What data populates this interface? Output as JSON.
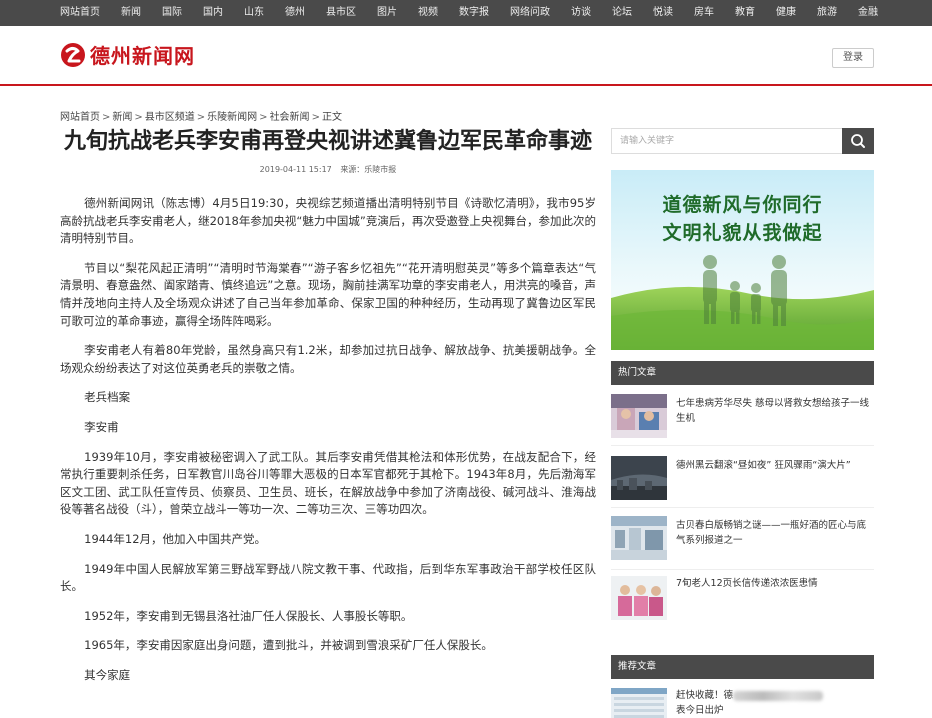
{
  "topnav": {
    "items": [
      "网站首页",
      "新闻",
      "国际",
      "国内",
      "山东",
      "德州",
      "县市区",
      "图片",
      "视频",
      "数字报",
      "网络问政",
      "访谈",
      "论坛",
      "悦读",
      "房车",
      "教育",
      "健康",
      "旅游",
      "金融"
    ]
  },
  "header": {
    "logo_text": "德州新闻网",
    "login_label": "登录",
    "brand_color": "#c8161d"
  },
  "breadcrumb": {
    "items": [
      "网站首页",
      "新闻",
      "县市区频道",
      "乐陵新闻网",
      "社会新闻",
      "正文"
    ],
    "separator": ">"
  },
  "article": {
    "title": "九旬抗战老兵李安甫再登央视讲述冀鲁边军民革命事迹",
    "date": "2019-04-11 15:17",
    "source": "来源：乐陵市报",
    "paragraphs": [
      "德州新闻网讯（陈志博）4月5日19:30，央视综艺频道播出清明特别节目《诗歌忆清明》，我市95岁高龄抗战老兵李安甫老人，继2018年参加央视“魅力中国城”竞演后，再次受邀登上央视舞台，参加此次的清明特别节目。",
      "节目以“梨花风起正清明”“清明时节海棠春”“游子客乡忆祖先”“花开清明慰英灵”等多个篇章表达“气清景明、春意盎然、阖家踏青、慎终追远”之意。现场，胸前挂满军功章的李安甫老人，用洪亮的嗓音，声情并茂地向主持人及全场观众讲述了自己当年参加革命、保家卫国的种种经历，生动再现了冀鲁边区军民可歌可泣的革命事迹，赢得全场阵阵喝彩。",
      "李安甫老人有着80年党龄，虽然身高只有1.2米，却参加过抗日战争、解放战争、抗美援朝战争。全场观众纷纷表达了对这位英勇老兵的崇敬之情。",
      "老兵档案",
      "李安甫",
      "1939年10月，李安甫被秘密调入了武工队。其后李安甫凭借其枪法和体形优势，在战友配合下，经常执行重要刺杀任务，日军教官川岛谷川等罪大恶极的日本军官都死于其枪下。1943年8月，先后渤海军区文工团、武工队任宣传员、侦察员、卫生员、班长，在解放战争中参加了济南战役、碱河战斗、淮海战役等著名战役（斗），曾荣立战斗一等功一次、二等功三次、三等功四次。",
      "1944年12月，他加入中国共产党。",
      "1949年中国人民解放军第三野战军野战八院文教干事、代政指，后到华东军事政治干部学校任区队长。",
      "1952年，李安甫到无锡县洛社油厂任人保股长、人事股长等职。",
      "1965年，李安甫因家庭出身问题，遭到批斗，并被调到雪浪采矿厂任人保股长。",
      "其今家庭"
    ]
  },
  "sidebar": {
    "search_placeholder": "请输入关键字",
    "banner": {
      "line1": "道德新风与你同行",
      "line2": "文明礼貌从我做起"
    },
    "hot_header": "热门文章",
    "hot_items": [
      {
        "title": "七年患病芳华尽失 慈母以肾救女想给孩子一线生机"
      },
      {
        "title": "德州黑云翻滚“昼如夜” 狂风骤雨“演大片”"
      },
      {
        "title": "古贝春白版畅销之谜——一瓶好酒的匠心与底气系列报道之一"
      },
      {
        "title": "7旬老人12页长信传递浓浓医患情"
      }
    ],
    "rec_header": "推荐文章",
    "rec_items": [
      {
        "title_prefix": "赶快收藏！德",
        "title_line2": "表今日出炉"
      }
    ]
  }
}
